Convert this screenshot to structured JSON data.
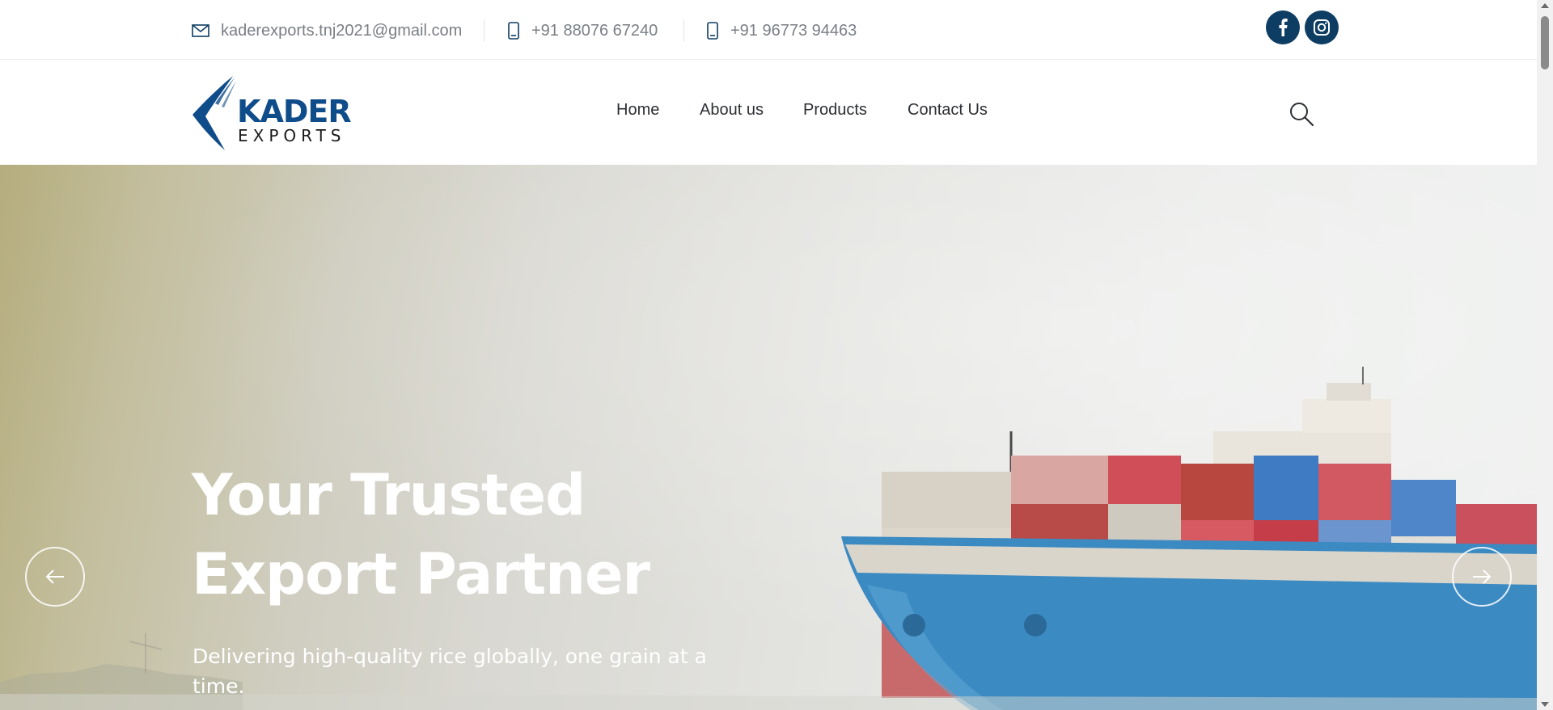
{
  "topbar": {
    "email": "kaderexports.tnj2021@gmail.com",
    "phone1": "+91 88076 67240",
    "phone2": "+91 96773 94463",
    "icons": {
      "email": "envelope-icon",
      "phone": "mobile-phone-icon",
      "facebook": "facebook-icon",
      "instagram": "instagram-icon"
    }
  },
  "header": {
    "logo": {
      "name": "KADER",
      "tagline": "EXPORTS"
    },
    "nav": [
      "Home",
      "About us",
      "Products",
      "Contact Us"
    ],
    "search_icon": "search-icon"
  },
  "hero": {
    "title": "Your Trusted Export Partner",
    "subtitle": "Delivering high-quality rice globally, one grain at a time.",
    "prev_icon": "arrow-left-icon",
    "next_icon": "arrow-right-icon"
  },
  "colors": {
    "brand_navy": "#0e3d63",
    "logo_blue": "#0f4c8a",
    "muted_text": "#7a7f86",
    "nav_text": "#2c2f33"
  }
}
